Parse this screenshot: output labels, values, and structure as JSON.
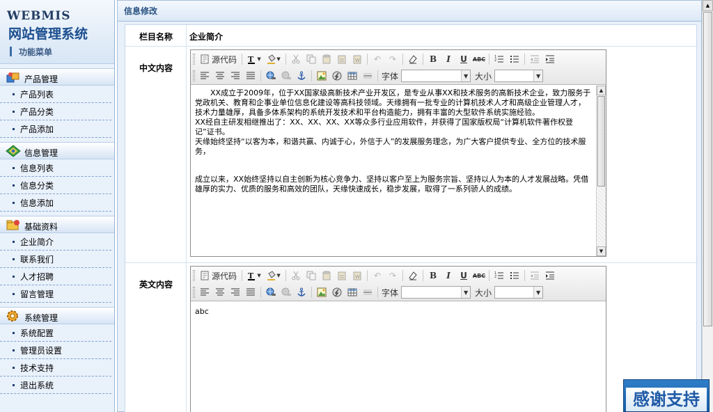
{
  "logo": {
    "en": "WEBMIS",
    "cn": "网站管理系统",
    "menu_title": "功能菜单"
  },
  "sidebar": {
    "groups": [
      {
        "title": "产品管理",
        "icon": "product-box-icon",
        "items": [
          "产品列表",
          "产品分类",
          "产品添加"
        ]
      },
      {
        "title": "信息管理",
        "icon": "info-diamond-icon",
        "items": [
          "信息列表",
          "信息分类",
          "信息添加"
        ]
      },
      {
        "title": "基础资料",
        "icon": "folder-icon",
        "items": [
          "企业简介",
          "联系我们",
          "人才招聘",
          "留言管理"
        ]
      },
      {
        "title": "系统管理",
        "icon": "gear-icon",
        "items": [
          "系统配置",
          "管理员设置",
          "技术支持",
          "退出系统"
        ]
      }
    ]
  },
  "main": {
    "heading": "信息修改",
    "rows": {
      "column_name_label": "栏目名称",
      "column_name_value": "企业简介",
      "cn_content_label": "中文内容",
      "en_content_label": "英文内容"
    }
  },
  "editor": {
    "source_label": "源代码",
    "font_label": "字体",
    "size_label": "大小",
    "buttons": {
      "bold": "B",
      "italic": "I",
      "underline": "U",
      "strike": "ABC"
    }
  },
  "content": {
    "cn_paragraphs": [
      "XX成立于2009年，位于XX国家级高新技术产业开发区，是专业从事XX和技术服务的高新技术企业，致力服务于党政机关、教育和企事业单位信息化建设等高科技领域。天缘拥有一批专业的计算机技术人才和高级企业管理人才，技术力量雄厚，具备多体系架构的系统开发技术和平台构造能力，拥有丰富的大型软件系统实施经验。",
      "XX经自主研发相继推出了：XX、XX、XX、XX等众多行业应用软件，并获得了国家版权局“计算机软件著作权登记”证书。",
      "天缘始终坚持“以客为本，和谐共赢、内诚于心，外信于人”的发展服务理念，为广大客户提供专业、全方位的技术服务，",
      "成立以来，XX始终坚持以自主创新为核心竞争力、坚持以客户至上为服务宗旨、坚持以人为本的人才发展战略。凭借雄厚的实力、优质的服务和高效的团队，天缘快速成长，稳步发展，取得了一系列骄人的成绩。"
    ],
    "en_text": "abc"
  },
  "badge": {
    "text": "感谢支持"
  }
}
